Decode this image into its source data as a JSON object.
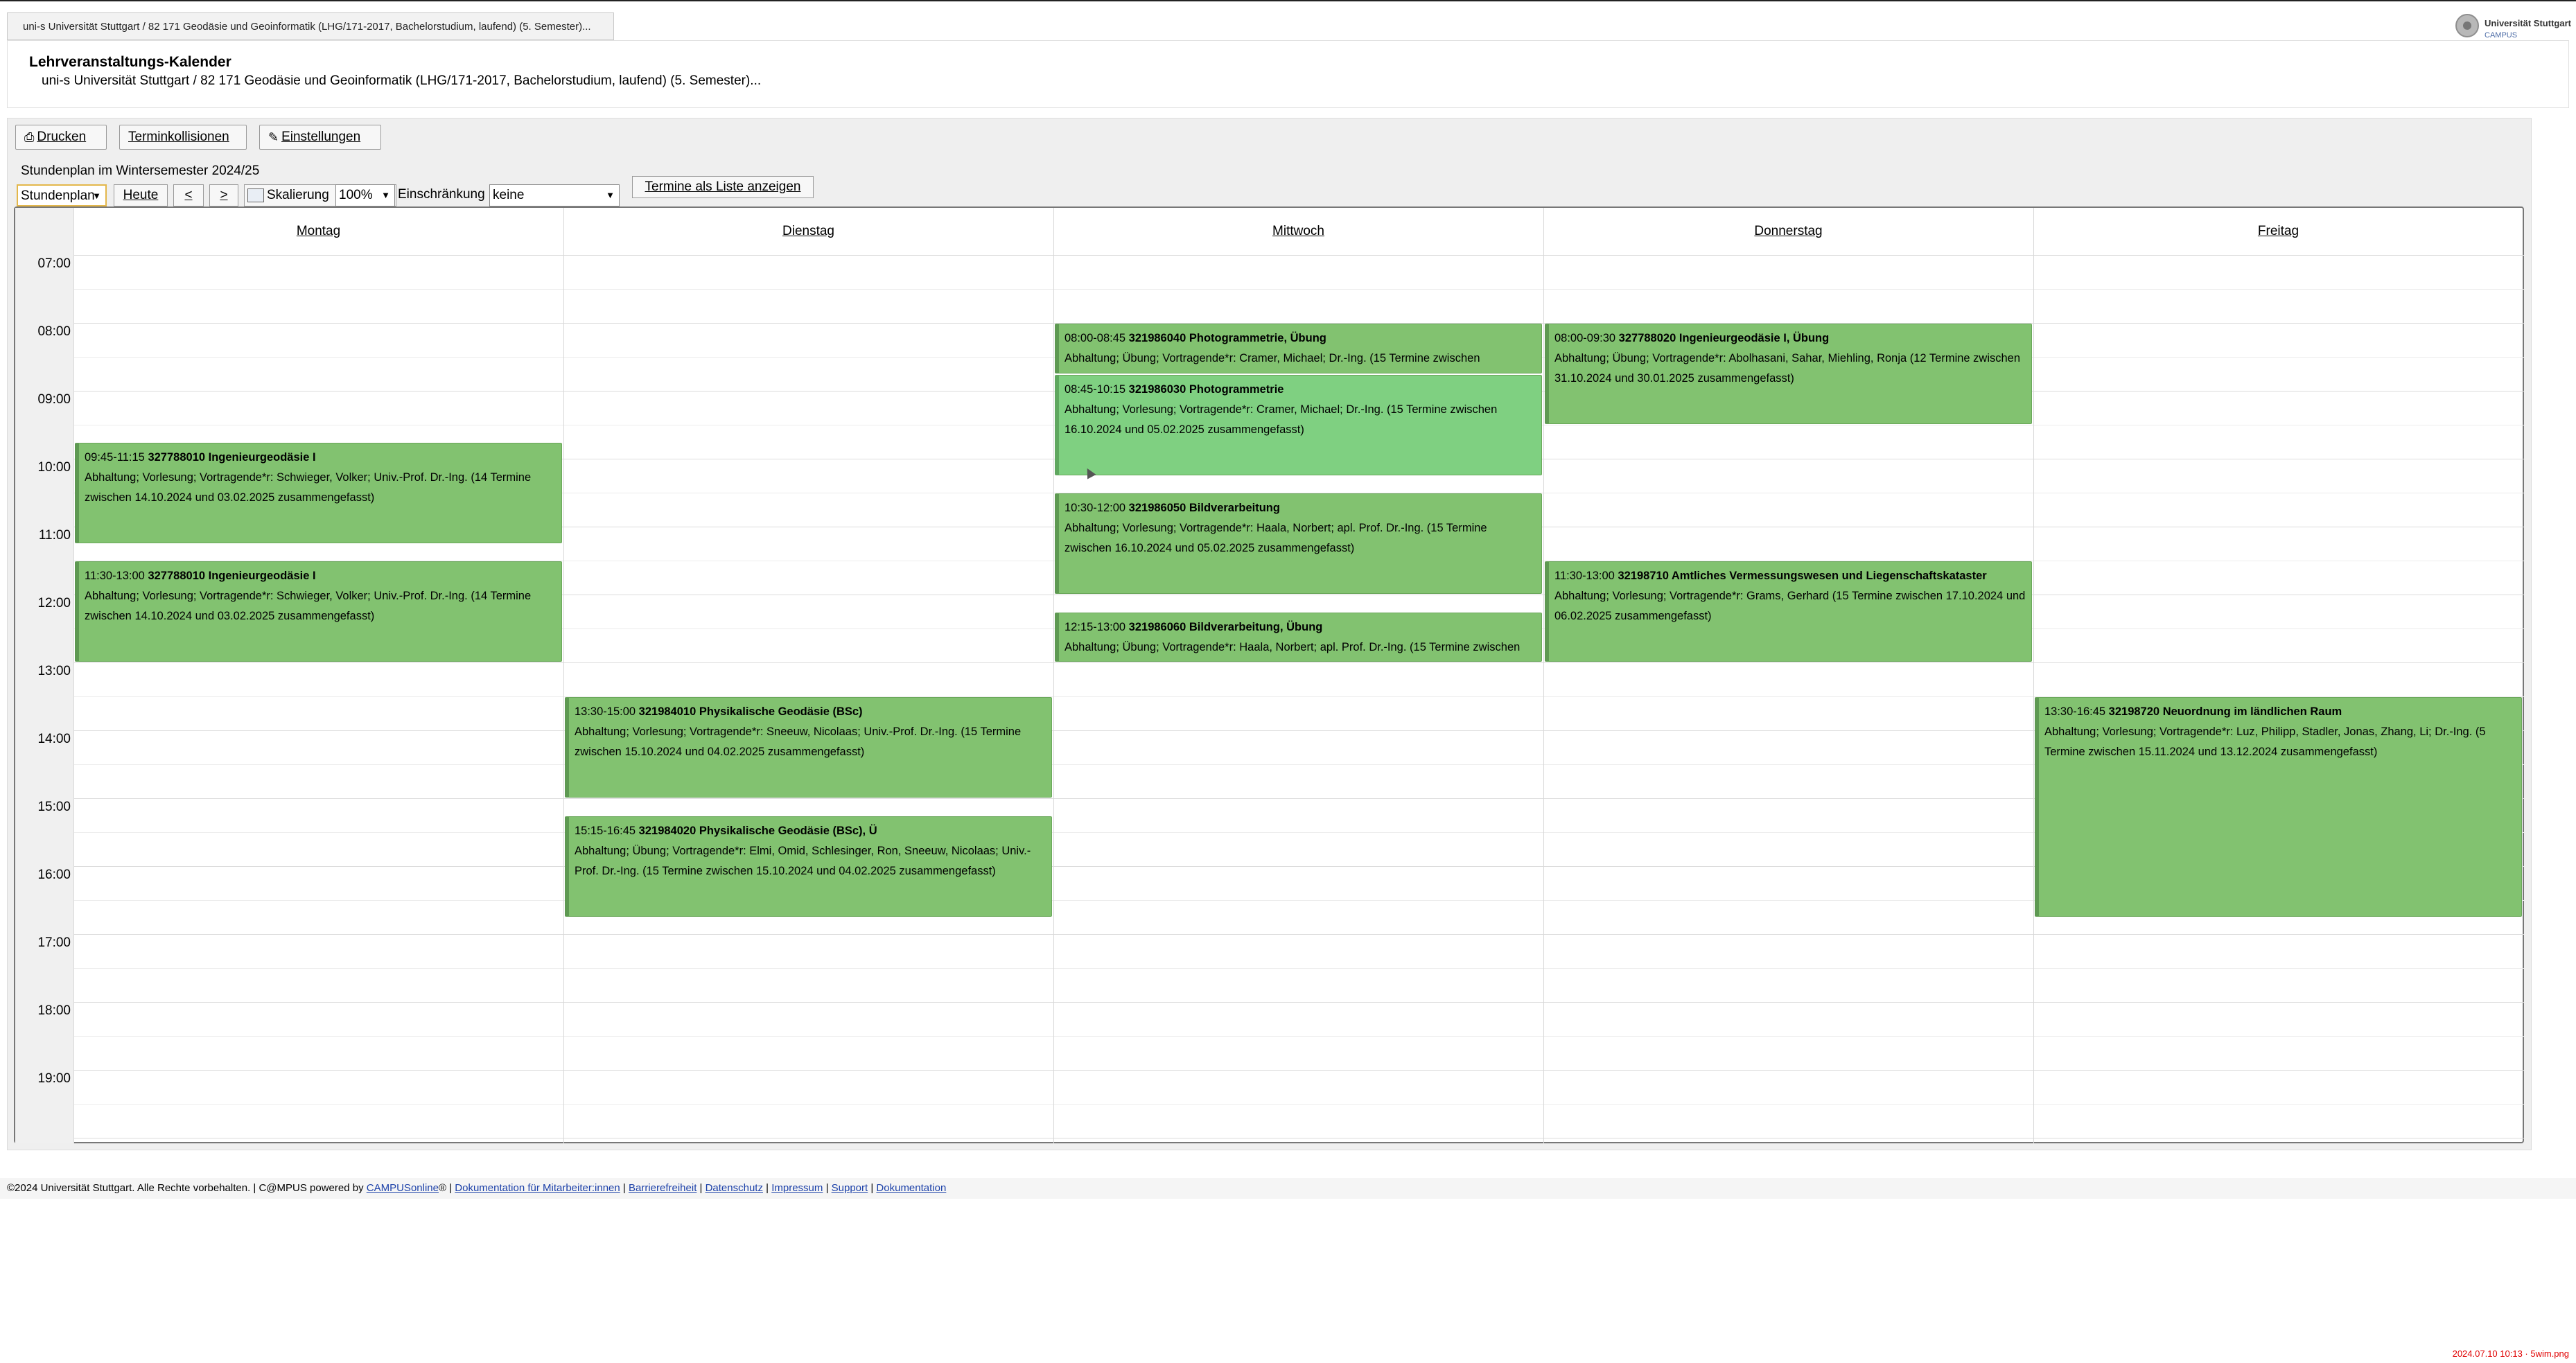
{
  "tab": {
    "label": "uni-s Universität Stuttgart / 82 171 Geodäsie und Geoinformatik (LHG/171-2017, Bachelorstudium, laufend) (5. Semester)..."
  },
  "logo": {
    "name": "Universität Stuttgart",
    "sub": "CAMPUS"
  },
  "header": {
    "title": "Lehrveranstaltungs-Kalender",
    "subtitle": "uni-s Universität Stuttgart / 82 171 Geodäsie und Geoinformatik (LHG/171-2017, Bachelorstudium, laufend) (5. Semester)..."
  },
  "toolbar": {
    "print": "Drucken",
    "collisions": "Terminkollisionen",
    "settings": "Einstellungen"
  },
  "semester_label": "Stundenplan im Wintersemester 2024/25",
  "controls": {
    "view_select": "Stundenplan",
    "today": "Heute",
    "prev": "<",
    "next": ">",
    "scale_label": "Skalierung",
    "scale_value": "100%",
    "restriction_label": "Einschränkung",
    "restriction_value": "keine",
    "list_button": "Termine als Liste anzeigen"
  },
  "calendar": {
    "days": [
      "Montag",
      "Dienstag",
      "Mittwoch",
      "Donnerstag",
      "Freitag"
    ],
    "hours": [
      "07:00",
      "08:00",
      "09:00",
      "10:00",
      "11:00",
      "12:00",
      "13:00",
      "14:00",
      "15:00",
      "16:00",
      "17:00",
      "18:00",
      "19:00"
    ],
    "events": [
      {
        "day": 0,
        "start": "09:45",
        "end": "11:15",
        "time": "09:45-11:15",
        "code": "327788010",
        "title": "Ingenieurgeodäsie I",
        "desc": "Abhaltung; Vorlesung; Vortragende*r: Schwieger, Volker; Univ.-Prof. Dr.-Ing. (14 Termine zwischen 14.10.2024 und 03.02.2025 zusammengefasst)"
      },
      {
        "day": 0,
        "start": "11:30",
        "end": "13:00",
        "time": "11:30-13:00",
        "code": "327788010",
        "title": "Ingenieurgeodäsie I",
        "desc": "Abhaltung; Vorlesung; Vortragende*r: Schwieger, Volker; Univ.-Prof. Dr.-Ing. (14 Termine zwischen 14.10.2024 und 03.02.2025 zusammengefasst)"
      },
      {
        "day": 1,
        "start": "13:30",
        "end": "15:00",
        "time": "13:30-15:00",
        "code": "321984010",
        "title": "Physikalische Geodäsie (BSc)",
        "desc": "Abhaltung; Vorlesung; Vortragende*r: Sneeuw, Nicolaas; Univ.-Prof. Dr.-Ing. (15 Termine zwischen 15.10.2024 und 04.02.2025 zusammengefasst)"
      },
      {
        "day": 1,
        "start": "15:15",
        "end": "16:45",
        "time": "15:15-16:45",
        "code": "321984020",
        "title": "Physikalische Geodäsie (BSc), Ü",
        "desc": "Abhaltung; Übung; Vortragende*r: Elmi, Omid, Schlesinger, Ron, Sneeuw, Nicolaas; Univ.-Prof. Dr.-Ing. (15 Termine zwischen 15.10.2024 und 04.02.2025 zusammengefasst)"
      },
      {
        "day": 2,
        "start": "08:00",
        "end": "08:45",
        "time": "08:00-08:45",
        "code": "321986040",
        "title": "Photogrammetrie, Übung",
        "desc": "Abhaltung; Übung; Vortragende*r: Cramer, Michael; Dr.-Ing. (15 Termine zwischen"
      },
      {
        "day": 2,
        "start": "08:45",
        "end": "10:15",
        "time": "08:45-10:15",
        "code": "321986030",
        "title": "Photogrammetrie",
        "desc": "Abhaltung; Vorlesung; Vortragende*r: Cramer, Michael; Dr.-Ing. (15 Termine zwischen 16.10.2024 und 05.02.2025 zusammengefasst)",
        "highlight": true
      },
      {
        "day": 2,
        "start": "10:30",
        "end": "12:00",
        "time": "10:30-12:00",
        "code": "321986050",
        "title": "Bildverarbeitung",
        "desc": "Abhaltung; Vorlesung; Vortragende*r: Haala, Norbert; apl. Prof. Dr.-Ing. (15 Termine zwischen 16.10.2024 und 05.02.2025 zusammengefasst)"
      },
      {
        "day": 2,
        "start": "12:15",
        "end": "13:00",
        "time": "12:15-13:00",
        "code": "321986060",
        "title": "Bildverarbeitung, Übung",
        "desc": "Abhaltung; Übung; Vortragende*r: Haala, Norbert; apl. Prof. Dr.-Ing. (15 Termine zwischen"
      },
      {
        "day": 3,
        "start": "08:00",
        "end": "09:30",
        "time": "08:00-09:30",
        "code": "327788020",
        "title": "Ingenieurgeodäsie I, Übung",
        "desc": "Abhaltung; Übung; Vortragende*r: Abolhasani, Sahar, Miehling, Ronja (12 Termine zwischen 31.10.2024 und 30.01.2025 zusammengefasst)"
      },
      {
        "day": 3,
        "start": "11:30",
        "end": "13:00",
        "time": "11:30-13:00",
        "code": "32198710",
        "title": "Amtliches Vermessungswesen und Liegenschaftskataster",
        "desc": "Abhaltung; Vorlesung; Vortragende*r: Grams, Gerhard (15 Termine zwischen 17.10.2024 und 06.02.2025 zusammengefasst)"
      },
      {
        "day": 4,
        "start": "13:30",
        "end": "16:45",
        "time": "13:30-16:45",
        "code": "32198720",
        "title": "Neuordnung im ländlichen Raum",
        "desc": "Abhaltung; Vorlesung; Vortragende*r: Luz, Philipp, Stadler, Jonas, Zhang, Li; Dr.-Ing. (5 Termine zwischen 15.11.2024 und 13.12.2024 zusammengefasst)"
      }
    ]
  },
  "footer": {
    "copyright": "©2024 Universität Stuttgart. Alle Rechte vorbehalten. | C@MPUS powered by ",
    "campusonline": "CAMPUSonline",
    "reg": "® | ",
    "links": [
      "Dokumentation für Mitarbeiter:innen",
      "Barrierefreiheit",
      "Datenschutz",
      "Impressum",
      "Support",
      "Dokumentation"
    ]
  },
  "stamp": "2024.07.10  10:13 · 5wim.png",
  "colors": {
    "event_bg": "#82c270",
    "event_highlight_bg": "#7fd081",
    "event_border": "#5e9952",
    "link": "#1a3fa8"
  }
}
